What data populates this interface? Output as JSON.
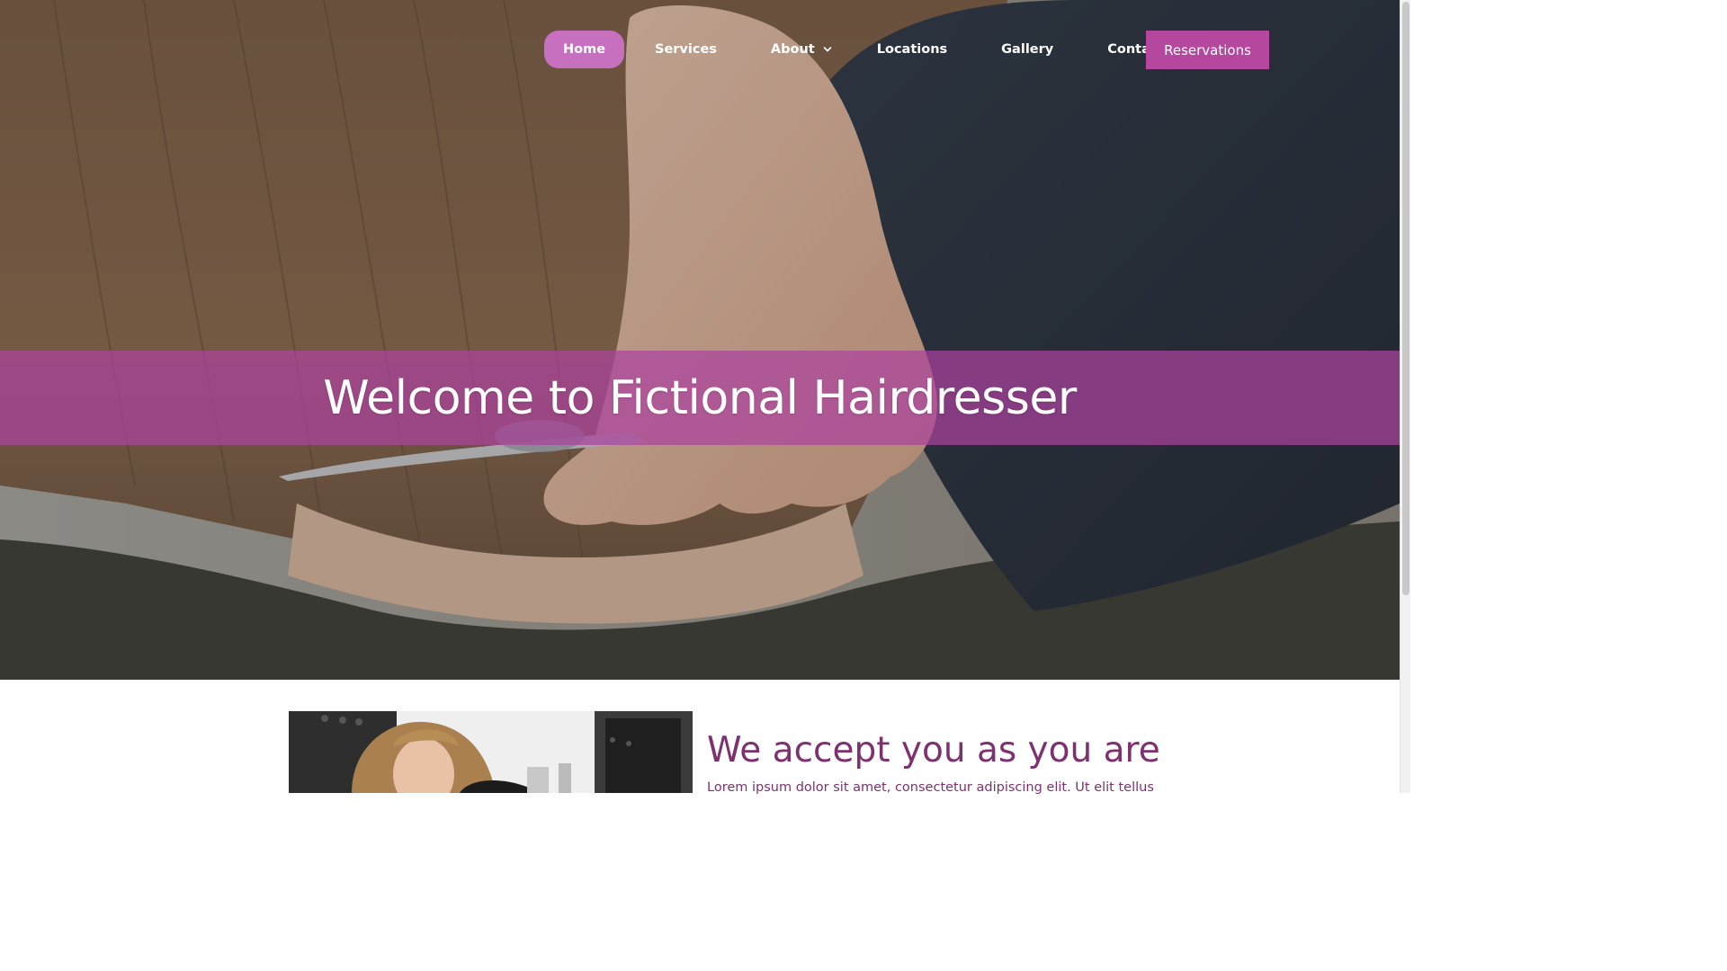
{
  "nav": {
    "items": [
      {
        "label": "Home",
        "active": true
      },
      {
        "label": "Services"
      },
      {
        "label": "About",
        "has_dropdown": true
      },
      {
        "label": "Locations"
      },
      {
        "label": "Gallery"
      },
      {
        "label": "Contact"
      }
    ],
    "cta_label": "Reservations",
    "icons": {
      "about_dropdown": "chevron-down-icon"
    }
  },
  "hero": {
    "title": "Welcome to Fictional Hairdresser",
    "image": "hairdresser cutting hair with scissors"
  },
  "content": {
    "heading": "We accept you as you are",
    "text": "Lorem ipsum dolor sit amet, consectetur adipiscing elit. Ut elit tellus",
    "image": "stylist at work in salon"
  },
  "colors": {
    "accent": "#b5479f",
    "nav_active": "#c870c0",
    "band": "#ac429e",
    "heading": "#7e3170"
  }
}
